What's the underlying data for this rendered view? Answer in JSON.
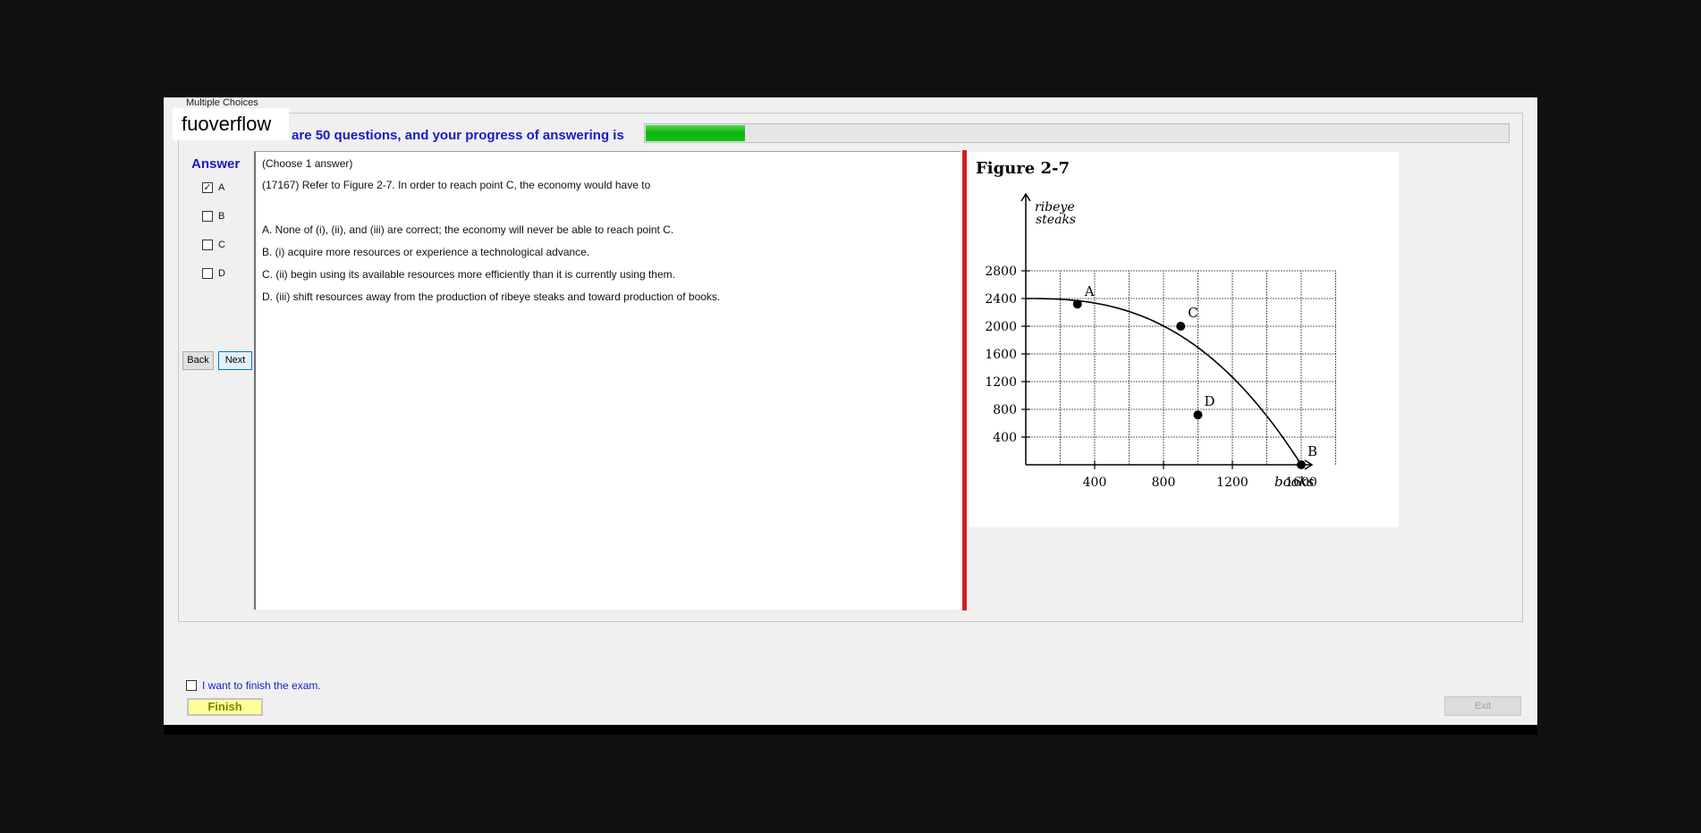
{
  "window": {
    "groupbox_title": "Multiple Choices",
    "overlay_label": "fuoverflow"
  },
  "progress": {
    "text": "There are 50 questions, and your progress of answering is",
    "fraction": 0.115
  },
  "answer": {
    "title": "Answer",
    "options": [
      {
        "label": "A",
        "checked": true
      },
      {
        "label": "B",
        "checked": false
      },
      {
        "label": "C",
        "checked": false
      },
      {
        "label": "D",
        "checked": false
      }
    ]
  },
  "nav": {
    "back": "Back",
    "next": "Next"
  },
  "question": {
    "instruction": "(Choose 1 answer)",
    "stem": "(17167)  Refer to Figure 2-7.  In order to reach point C, the economy would have to",
    "choices": [
      "A.  None of (i), (ii), and (iii) are correct; the economy will never be able to reach point C.",
      "B.  (i) acquire more resources or experience a technological advance.",
      "C.  (ii) begin using its available resources more efficiently than it is currently using them.",
      "D.  (iii) shift resources away from the production of ribeye steaks and toward production of books."
    ]
  },
  "figure": {
    "title": "Figure 2-7",
    "y_label_1": "ribeye",
    "y_label_2": "steaks",
    "x_label": "books",
    "y_ticks": [
      "2800",
      "2400",
      "2000",
      "1600",
      "1200",
      "800",
      "400"
    ],
    "x_ticks": [
      "400",
      "800",
      "1200",
      "1600"
    ],
    "points": [
      {
        "label": "A",
        "x": 300,
        "y": 2320
      },
      {
        "label": "C",
        "x": 900,
        "y": 2000
      },
      {
        "label": "D",
        "x": 1000,
        "y": 720
      },
      {
        "label": "B",
        "x": 1600,
        "y": 0
      }
    ]
  },
  "footer": {
    "finish_check": "I want to finish the exam.",
    "finish": "Finish",
    "exit": "Exit"
  }
}
